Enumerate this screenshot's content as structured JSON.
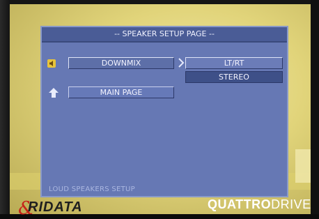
{
  "osd": {
    "title": "-- SPEAKER SETUP PAGE --",
    "menu": [
      {
        "label": "DOWNMIX",
        "icon": "speaker-icon",
        "selected": true
      },
      {
        "label": "MAIN PAGE",
        "icon": "arrow-up-icon",
        "selected": false
      }
    ],
    "options": [
      {
        "label": "LT/RT",
        "selected": false
      },
      {
        "label": "STEREO",
        "selected": true
      }
    ],
    "status": "LOUD SPEAKERS SETUP"
  },
  "brand": {
    "left": "RIDATA",
    "right_bold": "QUATTRO",
    "right_thin": "DRIVE"
  },
  "colors": {
    "panel": "#6678b4",
    "title_bar": "#4a5c96",
    "selected_option": "#3e5088",
    "backdrop": "#e1d47a",
    "brand_red": "#c6231a"
  }
}
